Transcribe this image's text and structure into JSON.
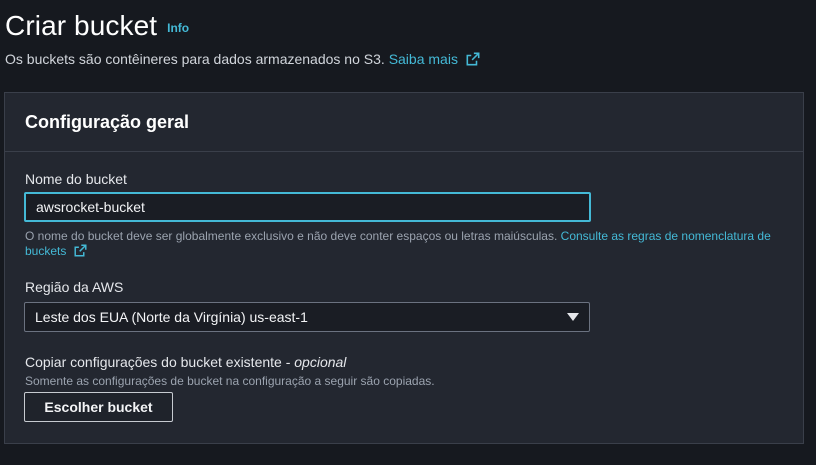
{
  "header": {
    "title": "Criar bucket",
    "info_label": "Info",
    "subtitle": "Os buckets são contêineres para dados armazenados no S3.",
    "learn_more": "Saiba mais"
  },
  "panel": {
    "title": "Configuração geral",
    "bucket_name": {
      "label": "Nome do bucket",
      "value": "awsrocket-bucket",
      "hint": "O nome do bucket deve ser globalmente exclusivo e não deve conter espaços ou letras maiúsculas.",
      "hint_link": "Consulte as regras de nomenclatura de buckets"
    },
    "region": {
      "label": "Região da AWS",
      "selected": "Leste dos EUA (Norte da Virgínia) us-east-1"
    },
    "copy_settings": {
      "label": "Copiar configurações do bucket existente - ",
      "optional": "opcional",
      "hint": "Somente as configurações de bucket na configuração a seguir são copiadas.",
      "button": "Escolher bucket"
    }
  },
  "colors": {
    "background": "#16191f",
    "panel": "#232730",
    "accent": "#44b9d6"
  },
  "icons": [
    "external-link-icon",
    "caret-down-icon"
  ]
}
